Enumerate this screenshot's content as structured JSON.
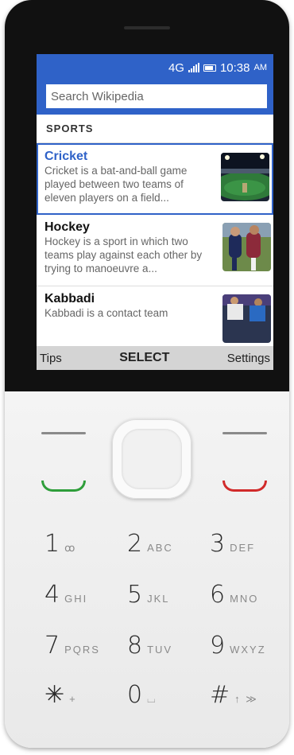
{
  "status_bar": {
    "network": "4G",
    "time": "10:38",
    "ampm": "AM"
  },
  "search": {
    "placeholder": "Search Wikipedia"
  },
  "section": {
    "title": "SPORTS"
  },
  "items": [
    {
      "title": "Cricket",
      "description": "Cricket is a bat-and-ball game played between two teams of eleven players on a field..."
    },
    {
      "title": "Hockey",
      "description": "Hockey is a sport in which two teams play against each other by trying to manoeuvre a..."
    },
    {
      "title": "Kabbadi",
      "description": "Kabbadi is a contact team"
    }
  ],
  "softkeys": {
    "left": "Tips",
    "center": "SELECT",
    "right": "Settings"
  },
  "colors": {
    "accent": "#2f62c8",
    "call_green": "#2e9e3a",
    "end_red": "#d12a2a"
  },
  "keypad": [
    {
      "num": "1",
      "letters": "ꝏ"
    },
    {
      "num": "2",
      "letters": "ABC"
    },
    {
      "num": "3",
      "letters": "DEF"
    },
    {
      "num": "4",
      "letters": "GHI"
    },
    {
      "num": "5",
      "letters": "JKL"
    },
    {
      "num": "6",
      "letters": "MNO"
    },
    {
      "num": "7",
      "letters": "PQRS"
    },
    {
      "num": "8",
      "letters": "TUV"
    },
    {
      "num": "9",
      "letters": "WXYZ"
    },
    {
      "num": "✳",
      "letters": "+"
    },
    {
      "num": "0",
      "letters": "⌴"
    },
    {
      "num": "#",
      "letters": "↑ ≫"
    }
  ]
}
